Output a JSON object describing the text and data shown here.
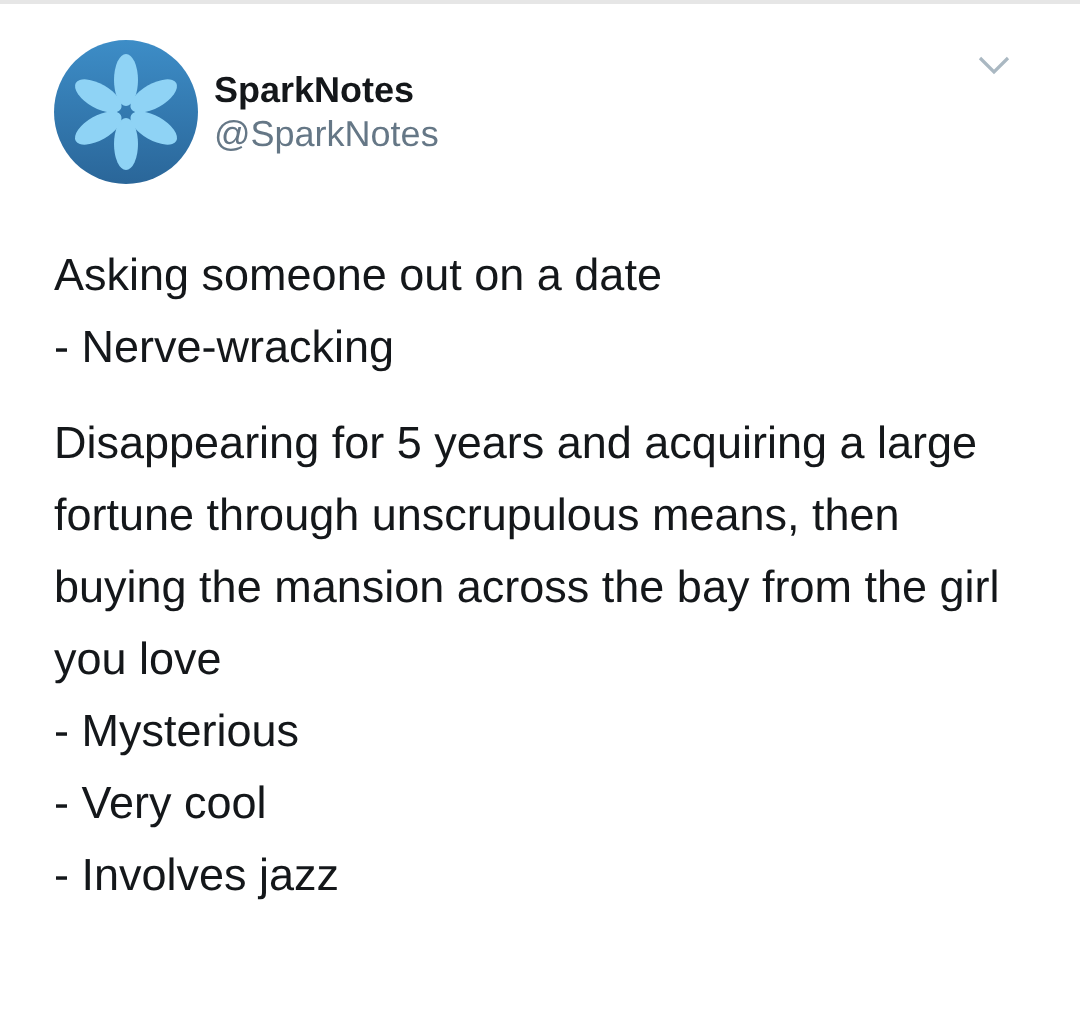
{
  "tweet": {
    "author_name": "SparkNotes",
    "handle": "@SparkNotes",
    "body": [
      {
        "lines": [
          "Asking someone out on a date",
          "- Nerve-wracking"
        ]
      },
      {
        "lines": [
          "Disappearing for 5 years and acquiring a large fortune through unscrupulous means, then buying the mansion across the bay from the girl you love",
          "- Mysterious",
          "- Very cool",
          "- Involves jazz"
        ]
      }
    ]
  }
}
